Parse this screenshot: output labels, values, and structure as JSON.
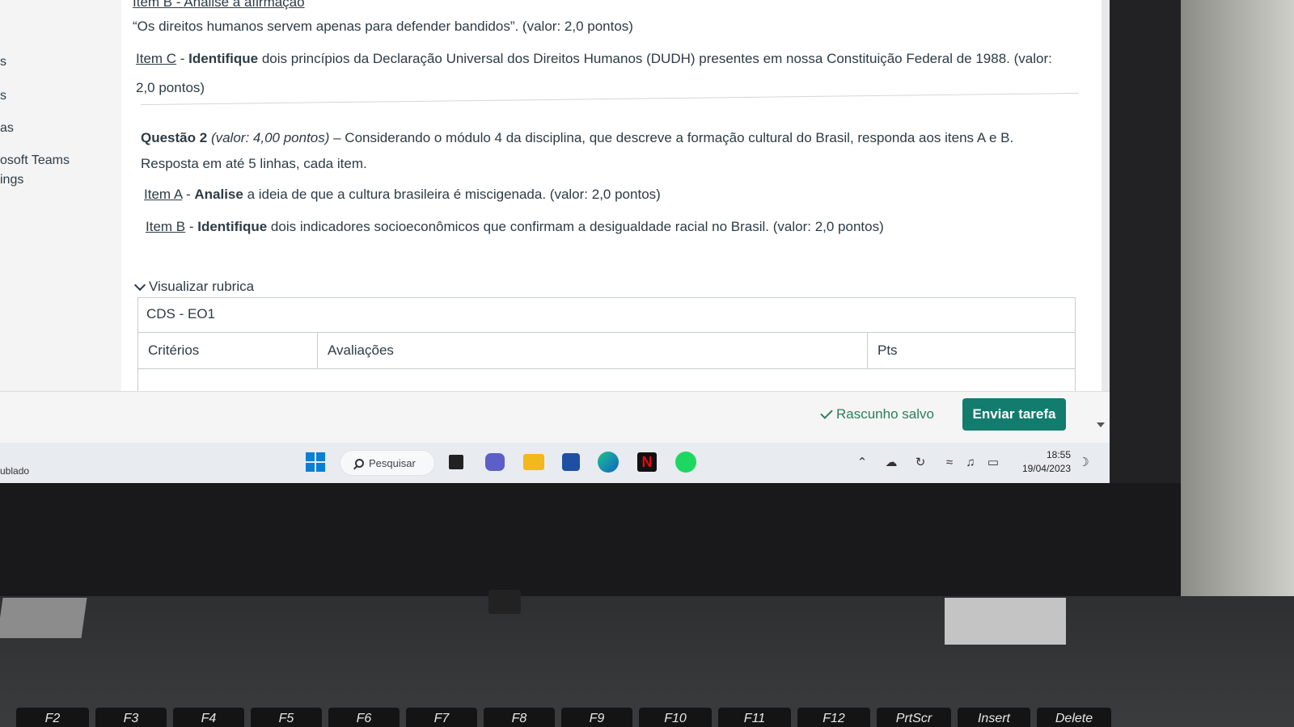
{
  "sidebar": {
    "items": [
      "s",
      "s",
      "as",
      "osoft Teams",
      "ings"
    ]
  },
  "content": {
    "top_fragment": "Item B - Analise a afirmação",
    "quote_line": "“Os direitos humanos servem apenas para defender bandidos”. (valor: 2,0 pontos)",
    "item_c": {
      "link": "Item C",
      "sep": " - ",
      "verb": "Identifique",
      "text": " dois princípios da Declaração Universal dos Direitos Humanos (DUDH) presentes em nossa Constituição Federal de 1988. (valor:",
      "cont": "2,0 pontos)"
    },
    "question2": {
      "label": "Questão 2",
      "value": "(valor: 4,00 pontos)",
      "text": " – Considerando o módulo 4 da disciplina, que descreve a formação cultural do Brasil, responda aos itens A e B.",
      "line2": "Resposta em até 5 linhas, cada item."
    },
    "item_a": {
      "link": "Item A",
      "sep": " - ",
      "verb": "Analise",
      "text": " a ideia de que a cultura brasileira é miscigenada. (valor: 2,0 pontos)"
    },
    "item_b": {
      "link": "Item B",
      "sep": " - ",
      "verb": "Identifique",
      "text": " dois indicadores socioeconômicos que confirmam a desigualdade racial no Brasil. (valor: 2,0 pontos)"
    }
  },
  "rubric": {
    "toggle_label": "Visualizar rubrica",
    "title": "CDS - EO1",
    "columns": [
      "Critérios",
      "Avaliações",
      "Pts"
    ]
  },
  "actions": {
    "draft_status": "Rascunho salvo",
    "submit_label": "Enviar tarefa"
  },
  "taskbar": {
    "left_label": "ublado",
    "search_label": "Pesquisar",
    "apps": [
      "start-icon",
      "search",
      "task-view-icon",
      "chat-icon",
      "file-explorer-icon",
      "store-icon",
      "edge-icon",
      "netflix-icon",
      "spotify-icon"
    ],
    "clock_time": "18:55",
    "clock_date": "19/04/2023"
  },
  "keyboard": {
    "keys": [
      "F2",
      "F3",
      "F4",
      "F5",
      "F6",
      "F7",
      "F8",
      "F9",
      "F10",
      "F11",
      "F12",
      "PrtScr",
      "Insert",
      "Delete"
    ]
  },
  "colors": {
    "accent": "#127c6e",
    "draft_green": "#2e7d5b",
    "text": "#2d3b45"
  }
}
